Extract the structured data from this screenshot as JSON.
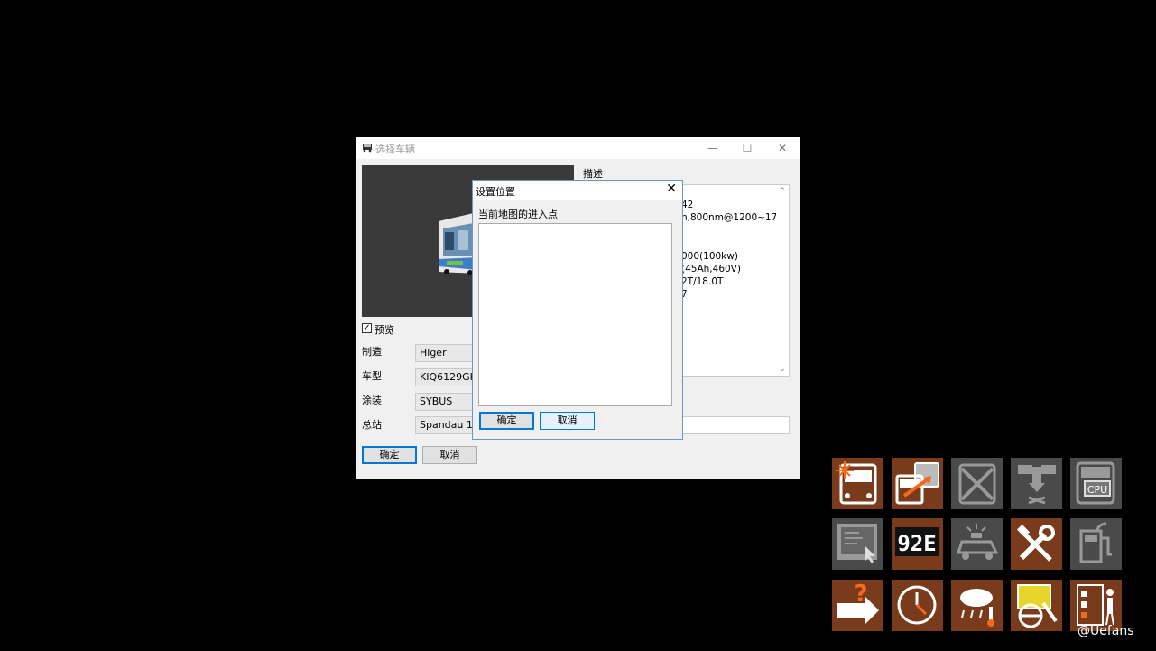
{
  "main_window": {
    "title": "选择车辆",
    "preview_checkbox_label": "预览",
    "labels": {
      "make": "制造",
      "model": "车型",
      "livery": "涂装",
      "terminal": "总站"
    },
    "values": {
      "make": "Hlger",
      "model": "KIQ6129GHE",
      "livery": "SYBUS",
      "terminal": "Spandau 198"
    },
    "ok_label": "确定",
    "cancel_label": "取消",
    "description_label": "描述",
    "description_lines": [
      "42",
      "h,800nm@1200~170",
      "000(100kw)",
      "(45Ah,460V)",
      "2T/18.0T",
      "7"
    ]
  },
  "dialog": {
    "title": "设置位置",
    "list_label": "当前地图的进入点",
    "ok_label": "确定",
    "cancel_label": "取消"
  },
  "tiles": [
    {
      "icon": "bus-light-icon",
      "color": "#7a3a1c"
    },
    {
      "icon": "bus-swap-icon",
      "color": "#7a3a1c"
    },
    {
      "icon": "bus-remove-icon",
      "color": "#4a4a4a"
    },
    {
      "icon": "bus-lower-icon",
      "color": "#4a4a4a"
    },
    {
      "icon": "bus-cpu-icon",
      "color": "#4a4a4a"
    },
    {
      "icon": "map-touch-icon",
      "color": "#4a4a4a"
    },
    {
      "icon": "route-number-icon",
      "color": "#7a3a1c"
    },
    {
      "icon": "police-car-icon",
      "color": "#4a4a4a"
    },
    {
      "icon": "repair-tools-icon",
      "color": "#7a3a1c"
    },
    {
      "icon": "fuel-pump-icon",
      "color": "#4a4a4a"
    },
    {
      "icon": "help-arrow-icon",
      "color": "#7a3a1c"
    },
    {
      "icon": "clock-icon",
      "color": "#7a3a1c"
    },
    {
      "icon": "weather-icon",
      "color": "#7a3a1c"
    },
    {
      "icon": "driver-bus-icon",
      "color": "#7a3a1c"
    },
    {
      "icon": "checklist-person-icon",
      "color": "#7a3a1c"
    }
  ],
  "watermark": "@Uefans"
}
